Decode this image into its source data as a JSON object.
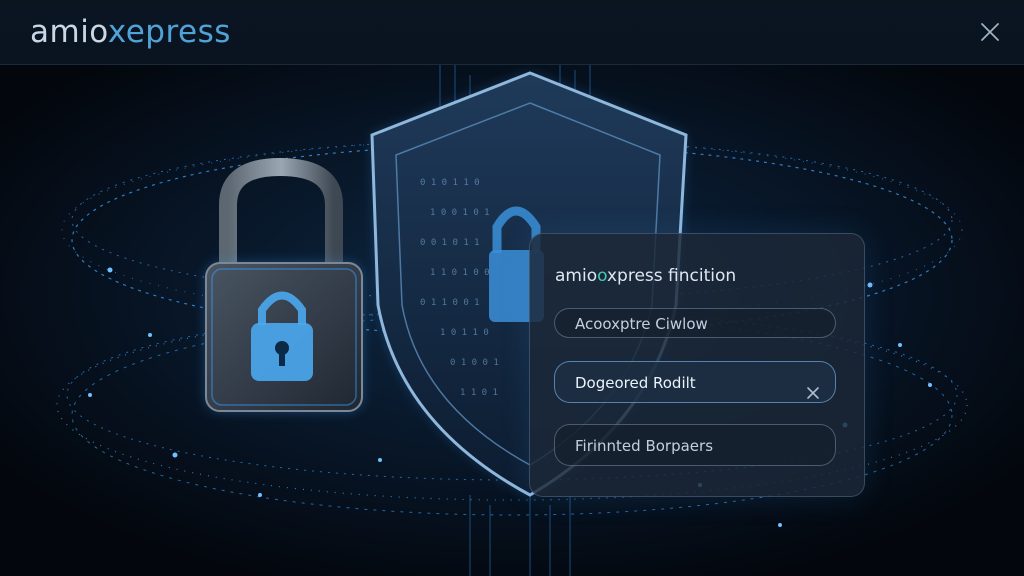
{
  "header": {
    "logo_part1": "amio",
    "logo_part2": "xepress"
  },
  "icons": {
    "close": "close-icon",
    "clear": "x-icon",
    "padlock": "padlock-icon",
    "shield": "shield-icon"
  },
  "panel": {
    "title_part1": "amio",
    "title_part2": "o",
    "title_part3": "xpress fincition",
    "field1": "Acooxptre Ciwlow",
    "field2": "Dogeored Rodilt",
    "field3": "Firinnted Borpaers"
  },
  "colors": {
    "accent": "#4fa3d8",
    "glow": "#3aa0ff",
    "background": "#050b14"
  }
}
